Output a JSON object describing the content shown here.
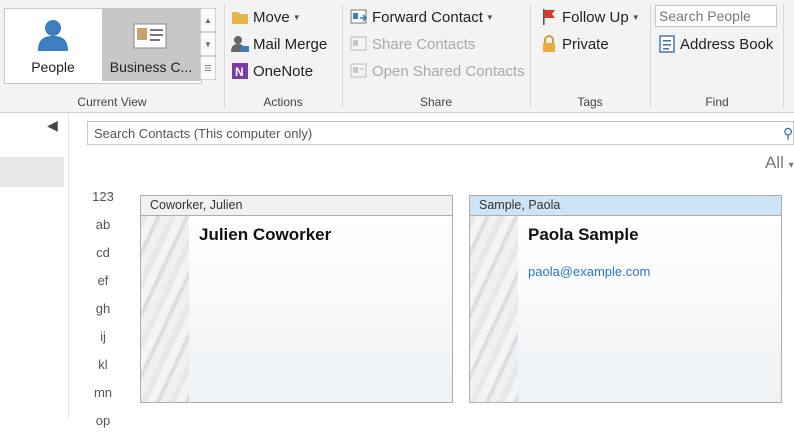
{
  "ribbon": {
    "current_view": {
      "group_label": "Current View",
      "people_label": "People",
      "business_label": "Business C..."
    },
    "actions": {
      "group_label": "Actions",
      "move_label": "Move",
      "mail_merge_label": "Mail Merge",
      "onenote_label": "OneNote"
    },
    "share": {
      "group_label": "Share",
      "forward_contact_label": "Forward Contact",
      "share_contacts_label": "Share Contacts",
      "open_shared_contacts_label": "Open Shared Contacts"
    },
    "tags": {
      "group_label": "Tags",
      "follow_up_label": "Follow Up",
      "private_label": "Private"
    },
    "find": {
      "group_label": "Find",
      "search_people_placeholder": "Search People",
      "address_book_label": "Address Book"
    }
  },
  "main": {
    "search_placeholder": "Search Contacts (This computer only)",
    "filter_label": "All",
    "alpha_index": [
      "123",
      "ab",
      "cd",
      "ef",
      "gh",
      "ij",
      "kl",
      "mn",
      "op"
    ],
    "cards": [
      {
        "header": "Coworker, Julien",
        "name": "Julien Coworker",
        "email": ""
      },
      {
        "header": "Sample, Paola",
        "name": "Paola Sample",
        "email": "paola@example.com"
      }
    ]
  },
  "colors": {
    "accent_blue": "#2a77c6",
    "selected_card_header": "#cde3f6",
    "ribbon_bg": "#f3f3f3"
  }
}
